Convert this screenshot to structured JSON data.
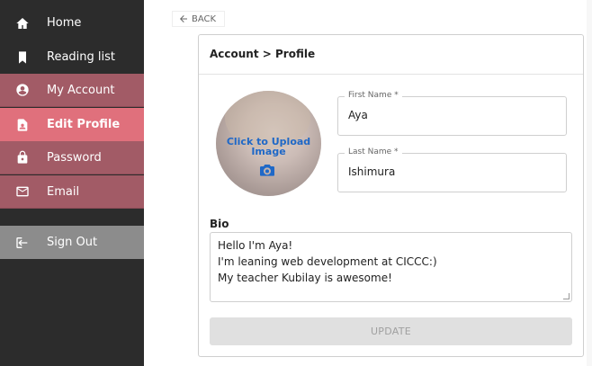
{
  "sidebar": {
    "items": [
      {
        "label": "Home",
        "icon": "home-icon"
      },
      {
        "label": "Reading list",
        "icon": "bookmark-icon"
      },
      {
        "label": "My Account",
        "icon": "account-circle-icon"
      },
      {
        "label": "Edit Profile",
        "icon": "profile-badge-icon"
      },
      {
        "label": "Password",
        "icon": "lock-icon"
      },
      {
        "label": "Email",
        "icon": "mail-icon"
      }
    ],
    "signout": {
      "label": "Sign Out",
      "icon": "logout-icon"
    }
  },
  "back_label": "BACK",
  "card": {
    "breadcrumb": "Account > Profile",
    "upload_text": "Click to Upload Image",
    "first_name": {
      "label": "First Name *",
      "value": "Aya"
    },
    "last_name": {
      "label": "Last Name *",
      "value": "Ishimura"
    },
    "bio_label": "Bio",
    "bio_lines": [
      "Hello I'm Aya!",
      "I'm leaning web development at CICCC:)",
      "My teacher Kubilay is awesome!"
    ],
    "update_label": "UPDATE"
  },
  "colors": {
    "sidebar_bg": "#2c2c2c",
    "account_section": "#a25b66",
    "active_item": "#e0707c",
    "signout_bg": "#8c8c8c",
    "link_blue": "#1f68c7"
  }
}
